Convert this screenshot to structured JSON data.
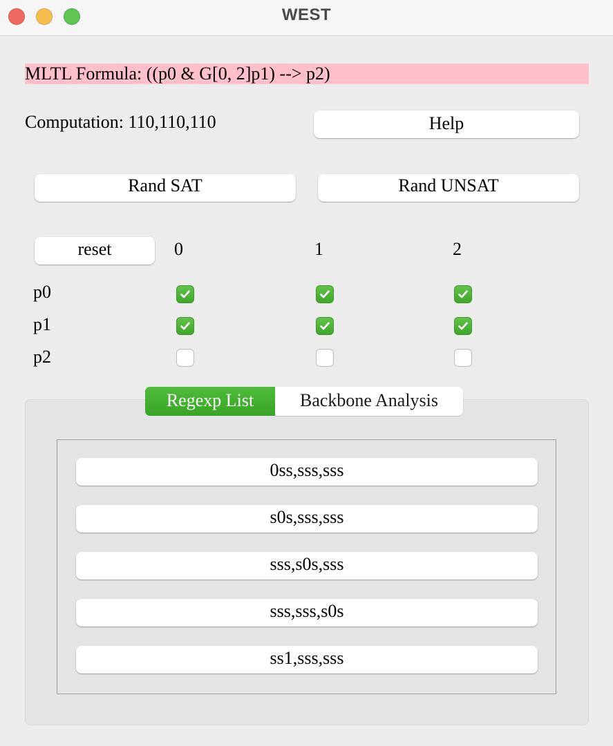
{
  "window": {
    "title": "WEST"
  },
  "formula": {
    "text": "MLTL Formula: ((p0 & G[0, 2]p1) --> p2)",
    "highlight_color": "#ffc0cb"
  },
  "computation": {
    "text": "Computation: 110,110,110"
  },
  "buttons": {
    "help": "Help",
    "rand_sat": "Rand SAT",
    "rand_unsat": "Rand UNSAT",
    "reset": "reset"
  },
  "grid": {
    "columns": [
      "0",
      "1",
      "2"
    ],
    "rows": [
      {
        "label": "p0",
        "values": [
          true,
          true,
          true
        ]
      },
      {
        "label": "p1",
        "values": [
          true,
          true,
          true
        ]
      },
      {
        "label": "p2",
        "values": [
          false,
          false,
          false
        ]
      }
    ],
    "checkbox_color": "#4cb33a"
  },
  "tabs": [
    {
      "label": "Regexp List",
      "selected": true
    },
    {
      "label": "Backbone Analysis",
      "selected": false
    }
  ],
  "regexp_list": [
    "0ss,sss,sss",
    "s0s,sss,sss",
    "sss,s0s,sss",
    "sss,sss,s0s",
    "ss1,sss,sss"
  ]
}
